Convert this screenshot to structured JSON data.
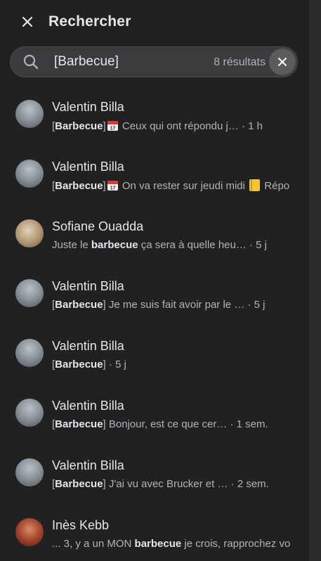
{
  "header": {
    "title": "Rechercher"
  },
  "search": {
    "value": "[Barbecue]",
    "count": "8 résultats"
  },
  "results": [
    {
      "name": "Valentin Billa",
      "pre": "[",
      "highlight": "Barbecue",
      "post": "]",
      "emoji": "calendar",
      "text": " Ceux qui ont répondu j…",
      "text2": "",
      "time": " · 1 h",
      "avatar": "v"
    },
    {
      "name": "Valentin Billa",
      "pre": "[",
      "highlight": "Barbecue",
      "post": "]",
      "emoji": "calendar",
      "text": " On va rester sur jeudi midi ",
      "text2": " Répo",
      "time": "",
      "avatar": "v"
    },
    {
      "name": "Sofiane Ouadda",
      "pre": "Juste le ",
      "highlight": "barbecue",
      "post": " ça sera à quelle heu…",
      "emoji": "",
      "text": "",
      "text2": "",
      "time": " · 5 j",
      "avatar": "s"
    },
    {
      "name": "Valentin Billa",
      "pre": "[",
      "highlight": "Barbecue",
      "post": "] Je me suis fait avoir par le …",
      "emoji": "",
      "text": "",
      "text2": "",
      "time": " · 5 j",
      "avatar": "v"
    },
    {
      "name": "Valentin Billa",
      "pre": "[",
      "highlight": "Barbecue",
      "post": "]",
      "emoji": "",
      "text": "",
      "text2": "",
      "time": " · 5 j",
      "avatar": "v"
    },
    {
      "name": "Valentin Billa",
      "pre": "[",
      "highlight": "Barbecue",
      "post": "] Bonjour, est ce que cer…",
      "emoji": "",
      "text": "",
      "text2": "",
      "time": " · 1 sem.",
      "avatar": "v"
    },
    {
      "name": "Valentin Billa",
      "pre": "[",
      "highlight": "Barbecue",
      "post": "] J'ai vu avec Brucker et …",
      "emoji": "",
      "text": "",
      "text2": "",
      "time": " · 2 sem.",
      "avatar": "v"
    },
    {
      "name": "Inès Kebb",
      "pre": "... 3, y a un MON ",
      "highlight": "barbecue",
      "post": " je crois, rapprochez vo",
      "emoji": "",
      "text": "",
      "text2": "",
      "time": "",
      "avatar": "i"
    }
  ]
}
